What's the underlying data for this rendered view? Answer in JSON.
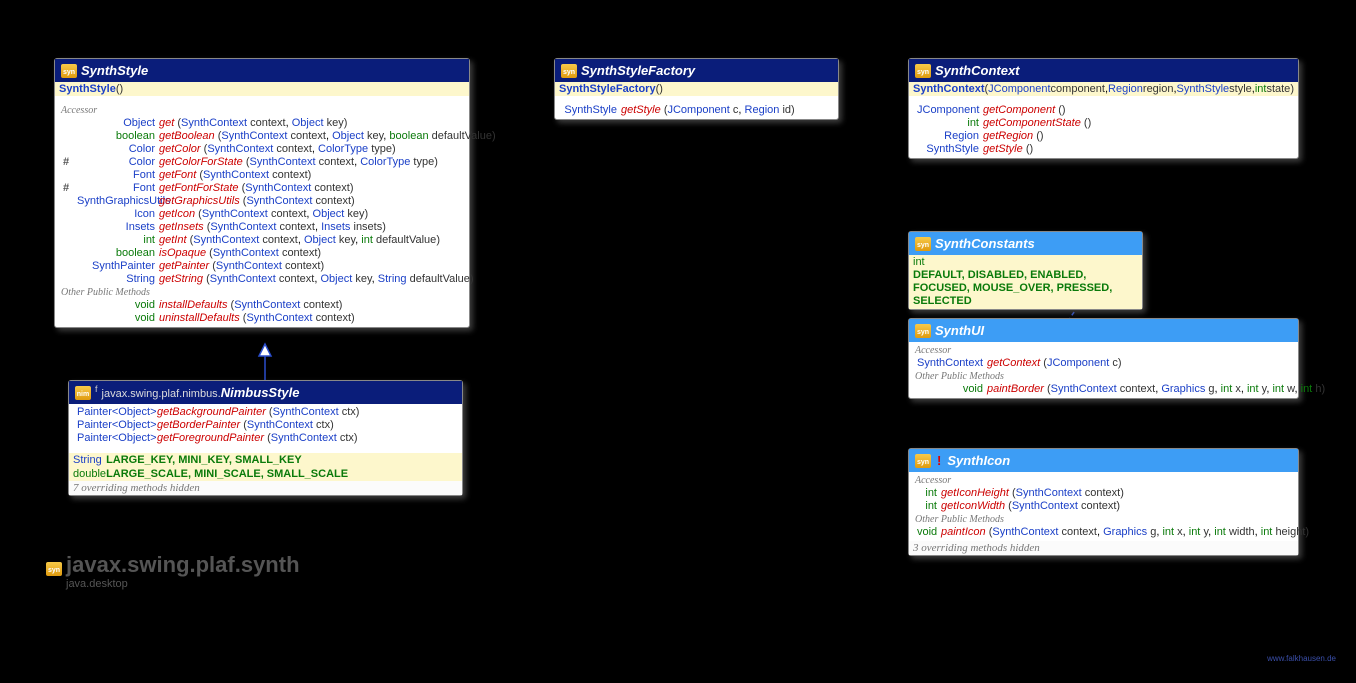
{
  "package": {
    "name": "javax.swing.plaf.synth",
    "module": "java.desktop"
  },
  "credit": "www.falkhausen.de",
  "classes": {
    "synthStyle": {
      "name": "SynthStyle",
      "ctor": {
        "name": "SynthStyle",
        "params": "()"
      },
      "sections": {
        "accessor": "Accessor",
        "other": "Other Public Methods"
      },
      "methods": {
        "get": {
          "ret": "Object",
          "retKind": "class",
          "name": "get",
          "sig": "(SynthContext context, Object key)"
        },
        "getBool": {
          "ret": "boolean",
          "retKind": "prim",
          "name": "getBoolean",
          "sig": "(SynthContext context, Object key, boolean defaultValue)"
        },
        "getColor": {
          "ret": "Color",
          "retKind": "class",
          "name": "getColor",
          "sig": "(SynthContext context, ColorType type)"
        },
        "getColorS": {
          "mod": "#",
          "ret": "Color",
          "retKind": "class",
          "name": "getColorForState",
          "sig": "(SynthContext context, ColorType type)"
        },
        "getFont": {
          "ret": "Font",
          "retKind": "class",
          "name": "getFont",
          "sig": "(SynthContext context)"
        },
        "getFontS": {
          "mod": "#",
          "ret": "Font",
          "retKind": "class",
          "name": "getFontForState",
          "sig": "(SynthContext context)"
        },
        "getGU": {
          "ret": "SynthGraphicsUtils",
          "retKind": "class",
          "name": "getGraphicsUtils",
          "sig": "(SynthContext context)"
        },
        "getIcon": {
          "ret": "Icon",
          "retKind": "class",
          "name": "getIcon",
          "sig": "(SynthContext context, Object key)"
        },
        "getInsets": {
          "ret": "Insets",
          "retKind": "class",
          "name": "getInsets",
          "sig": "(SynthContext context, Insets insets)"
        },
        "getInt": {
          "ret": "int",
          "retKind": "prim",
          "name": "getInt",
          "sig": "(SynthContext context, Object key, int defaultValue)"
        },
        "isOpaque": {
          "ret": "boolean",
          "retKind": "prim",
          "name": "isOpaque",
          "sig": "(SynthContext context)"
        },
        "getPaint": {
          "ret": "SynthPainter",
          "retKind": "class",
          "name": "getPainter",
          "sig": "(SynthContext context)"
        },
        "getStr": {
          "ret": "String",
          "retKind": "class",
          "name": "getString",
          "sig": "(SynthContext context, Object key, String defaultValue)"
        },
        "install": {
          "ret": "void",
          "retKind": "prim",
          "name": "installDefaults",
          "sig": "(SynthContext context)"
        },
        "uninstall": {
          "ret": "void",
          "retKind": "prim",
          "name": "uninstallDefaults",
          "sig": "(SynthContext context)"
        }
      }
    },
    "nimbusStyle": {
      "pkgPrefix": "javax.swing.plaf.nimbus.",
      "name": "NimbusStyle",
      "fMark": "f",
      "methods": {
        "bgP": {
          "ret": "Painter<Object>",
          "retKind": "class",
          "name": "getBackgroundPainter",
          "sig": "(SynthContext ctx)"
        },
        "bdP": {
          "ret": "Painter<Object>",
          "retKind": "class",
          "name": "getBorderPainter",
          "sig": "(SynthContext ctx)"
        },
        "fgP": {
          "ret": "Painter<Object>",
          "retKind": "class",
          "name": "getForegroundPainter",
          "sig": "(SynthContext ctx)"
        }
      },
      "consts": {
        "keys": {
          "type": "String",
          "names": "LARGE_KEY, MINI_KEY, SMALL_KEY"
        },
        "scales": {
          "type": "double",
          "names": "LARGE_SCALE, MINI_SCALE, SMALL_SCALE"
        }
      },
      "hidden": "7 overriding methods hidden"
    },
    "synthStyleFactory": {
      "name": "SynthStyleFactory",
      "ctor": {
        "name": "SynthStyleFactory",
        "params": "()"
      },
      "methods": {
        "getStyle": {
          "ret": "SynthStyle",
          "retKind": "class",
          "name": "getStyle",
          "sig": "(JComponent c, Region id)"
        }
      }
    },
    "synthContext": {
      "name": "SynthContext",
      "ctor": {
        "name": "SynthContext",
        "params": "(JComponent component, Region region, SynthStyle style, int state)"
      },
      "methods": {
        "getComp": {
          "ret": "JComponent",
          "retKind": "class",
          "name": "getComponent",
          "sig": "()"
        },
        "getCS": {
          "ret": "int",
          "retKind": "prim",
          "name": "getComponentState",
          "sig": "()"
        },
        "getReg": {
          "ret": "Region",
          "retKind": "class",
          "name": "getRegion",
          "sig": "()"
        },
        "getStyle": {
          "ret": "SynthStyle",
          "retKind": "class",
          "name": "getStyle",
          "sig": "()"
        }
      }
    },
    "synthConstants": {
      "name": "SynthConstants",
      "consts": {
        "type": "int",
        "names": "DEFAULT, DISABLED, ENABLED, FOCUSED, MOUSE_OVER, PRESSED, SELECTED"
      }
    },
    "synthUI": {
      "name": "SynthUI",
      "sections": {
        "accessor": "Accessor",
        "other": "Other Public Methods"
      },
      "methods": {
        "getCtx": {
          "ret": "SynthContext",
          "retKind": "class",
          "name": "getContext",
          "sig": "(JComponent c)"
        },
        "paintB": {
          "ret": "void",
          "retKind": "prim",
          "name": "paintBorder",
          "sig": "(SynthContext context, Graphics g, int x, int y, int w, int h)"
        }
      }
    },
    "synthIcon": {
      "name": "SynthIcon",
      "sections": {
        "accessor": "Accessor",
        "other": "Other Public Methods"
      },
      "methods": {
        "getH": {
          "ret": "int",
          "retKind": "prim",
          "name": "getIconHeight",
          "sig": "(SynthContext context)"
        },
        "getW": {
          "ret": "int",
          "retKind": "prim",
          "name": "getIconWidth",
          "sig": "(SynthContext context)"
        },
        "paint": {
          "ret": "void",
          "retKind": "prim",
          "name": "paintIcon",
          "sig": "(SynthContext context, Graphics g, int x, int y, int width, int height)"
        }
      },
      "hidden": "3 overriding methods hidden"
    }
  }
}
